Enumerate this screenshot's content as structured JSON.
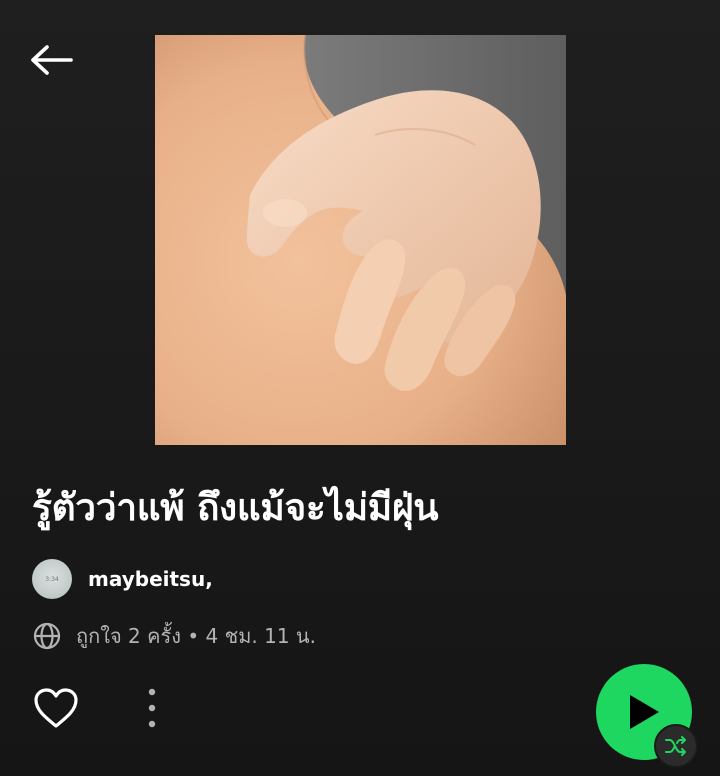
{
  "header": {
    "back_icon": "arrow-left-icon"
  },
  "playlist": {
    "title": "รู้ตัวว่าแพ้ ถึงแม้จะไม่มีฝุ่น",
    "owner": "maybeitsu,",
    "avatar_text": "3:34",
    "meta": "ถูกใจ 2 ครั้ง • 4 ชม. 11 น.",
    "cover_description_icon": "cover-art-image"
  },
  "actions": {
    "like_icon": "heart-outline-icon",
    "more_icon": "more-vertical-icon",
    "play_icon": "play-icon",
    "shuffle_icon": "shuffle-icon"
  },
  "colors": {
    "accent": "#1ed760",
    "background": "#1b1b1b",
    "secondary_text": "#b3b3b3"
  }
}
